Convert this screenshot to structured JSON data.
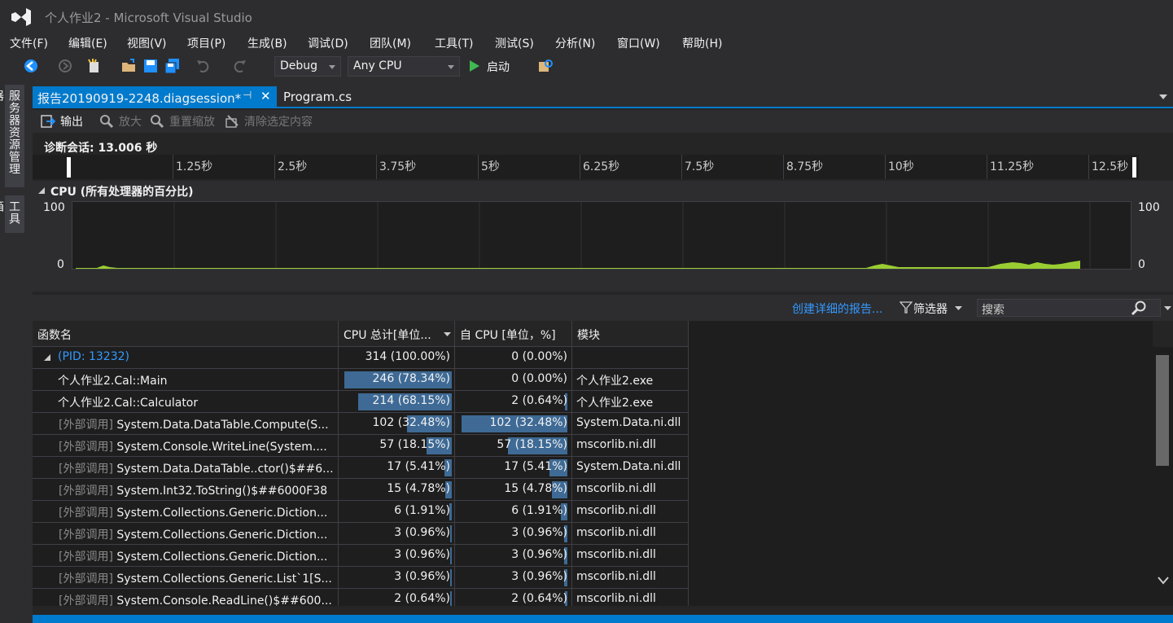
{
  "window": {
    "title": "个人作业2 - Microsoft Visual Studio"
  },
  "menu": [
    "文件(F)",
    "编辑(E)",
    "视图(V)",
    "项目(P)",
    "生成(B)",
    "调试(D)",
    "团队(M)",
    "工具(T)",
    "测试(S)",
    "分析(N)",
    "窗口(W)",
    "帮助(H)"
  ],
  "toolbar": {
    "config": "Debug",
    "platform": "Any CPU",
    "start_label": "启动"
  },
  "sidebar": {
    "server_explorer": "服务器资源管理器",
    "toolbox": "工具箱"
  },
  "tabs": {
    "active": "报告20190919-2248.diagsession*",
    "second": "Program.cs"
  },
  "diag_toolbar": {
    "output": "输出",
    "zoom_in": "放大",
    "reset_zoom": "重置缩放",
    "clear_selection": "清除选定内容"
  },
  "session": {
    "label": "诊断会话: 13.006 秒"
  },
  "ruler": [
    "1.25秒",
    "2.5秒",
    "3.75秒",
    "5秒",
    "6.25秒",
    "7.5秒",
    "8.75秒",
    "10秒",
    "11.25秒",
    "12.5秒"
  ],
  "cpu": {
    "title": "CPU (所有处理器的百分比)",
    "ymax": "100",
    "ymin": "0"
  },
  "filterbar": {
    "report_link": "创建详细的报告...",
    "filter": "筛选器",
    "search_placeholder": "搜索"
  },
  "columns": [
    "函数名",
    "CPU 总计[单位...",
    "自 CPU [单位，%]",
    "模块"
  ],
  "rows": [
    {
      "prefix": "",
      "name": "(PID: 13232)",
      "total": "314 (100.00%)",
      "total_pct": 100.0,
      "self": "0 (0.00%)",
      "self_pct": 0.0,
      "module": ""
    },
    {
      "prefix": "",
      "name": "个人作业2.Cal::Main",
      "total": "246 (78.34%)",
      "total_pct": 78.34,
      "self": "0 (0.00%)",
      "self_pct": 0.0,
      "module": "个人作业2.exe"
    },
    {
      "prefix": "",
      "name": "个人作业2.Cal::Calculator",
      "total": "214 (68.15%)",
      "total_pct": 68.15,
      "self": "2 (0.64%)",
      "self_pct": 0.64,
      "module": "个人作业2.exe"
    },
    {
      "prefix": "[外部调用]",
      "name": "System.Data.DataTable.Compute(S...",
      "total": "102 (32.48%)",
      "total_pct": 32.48,
      "self": "102 (32.48%)",
      "self_pct": 32.48,
      "module": "System.Data.ni.dll"
    },
    {
      "prefix": "[外部调用]",
      "name": "System.Console.WriteLine(System....",
      "total": "57 (18.15%)",
      "total_pct": 18.15,
      "self": "57 (18.15%)",
      "self_pct": 18.15,
      "module": "mscorlib.ni.dll"
    },
    {
      "prefix": "[外部调用]",
      "name": "System.Data.DataTable..ctor()$##6...",
      "total": "17 (5.41%)",
      "total_pct": 5.41,
      "self": "17 (5.41%)",
      "self_pct": 5.41,
      "module": "System.Data.ni.dll"
    },
    {
      "prefix": "[外部调用]",
      "name": "System.Int32.ToString()$##6000F38",
      "total": "15 (4.78%)",
      "total_pct": 4.78,
      "self": "15 (4.78%)",
      "self_pct": 4.78,
      "module": "mscorlib.ni.dll"
    },
    {
      "prefix": "[外部调用]",
      "name": "System.Collections.Generic.Diction...",
      "total": "6 (1.91%)",
      "total_pct": 1.91,
      "self": "6 (1.91%)",
      "self_pct": 1.91,
      "module": "mscorlib.ni.dll"
    },
    {
      "prefix": "[外部调用]",
      "name": "System.Collections.Generic.Diction...",
      "total": "3 (0.96%)",
      "total_pct": 0.96,
      "self": "3 (0.96%)",
      "self_pct": 0.96,
      "module": "mscorlib.ni.dll"
    },
    {
      "prefix": "[外部调用]",
      "name": "System.Collections.Generic.Diction...",
      "total": "3 (0.96%)",
      "total_pct": 0.96,
      "self": "3 (0.96%)",
      "self_pct": 0.96,
      "module": "mscorlib.ni.dll"
    },
    {
      "prefix": "[外部调用]",
      "name": "System.Collections.Generic.List`1[S...",
      "total": "3 (0.96%)",
      "total_pct": 0.96,
      "self": "3 (0.96%)",
      "self_pct": 0.96,
      "module": "mscorlib.ni.dll"
    },
    {
      "prefix": "[外部调用]",
      "name": "System.Console.ReadLine()$##600...",
      "total": "2 (0.64%)",
      "total_pct": 0.64,
      "self": "2 (0.64%)",
      "self_pct": 0.64,
      "module": "mscorlib.ni.dll"
    }
  ],
  "colors": {
    "bg": "#2d2d30",
    "accent": "#007acc",
    "bar": "#3e6a95",
    "cpu_line": "#9acd32",
    "link": "#3399ff"
  }
}
